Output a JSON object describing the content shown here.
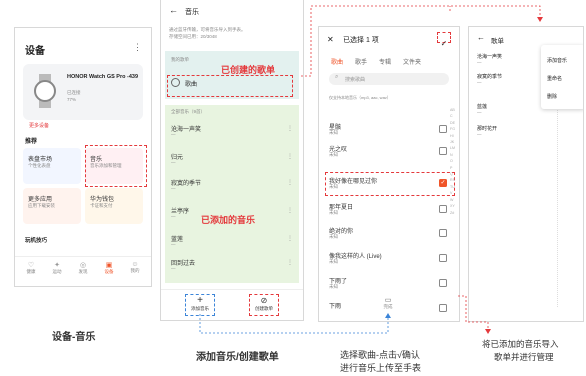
{
  "screen1": {
    "title": "设备",
    "more": "⋮",
    "device_name": "HONOR Watch GS Pro -439",
    "device_status1": "已连接",
    "device_status2": "77%",
    "update_link": "更多设备",
    "recommend": "推荐",
    "cards": [
      {
        "title": "表盘市场",
        "sub": "个性化表盘"
      },
      {
        "title": "音乐",
        "sub": "音乐添加和管理"
      },
      {
        "title": "更多应用",
        "sub": "应用下载安装"
      },
      {
        "title": "华为钱包",
        "sub": "卡证和支付"
      }
    ],
    "section2": "玩机技巧",
    "tabs": [
      "健康",
      "运动",
      "发现",
      "设备",
      "我的"
    ]
  },
  "screen2": {
    "back_icon": "←",
    "title": "音乐",
    "desc1": "通过蓝牙传输，可将音乐导入到手表。",
    "desc2": "存储空间已用：20/3048",
    "section_mine": "我的歌单",
    "playlist_name": "歌曲",
    "annotation_created": "已创建的歌单",
    "section_all": "全部音乐（9首）",
    "songs": [
      "沧海一声笑",
      "归元",
      "寂寞的季节",
      "兰亭序",
      "蓝莲",
      "回到过去",
      "稻香"
    ],
    "annotation_added": "已添加的音乐",
    "add_btn_label": "添加音乐",
    "create_btn_label": "创建歌单"
  },
  "screen3": {
    "close_icon": "✕",
    "title": "已选择 1 项",
    "tabs": [
      "歌曲",
      "歌手",
      "专辑",
      "文件夹"
    ],
    "search_placeholder": "搜索歌曲",
    "hint": "仅支持本地音乐（mp3, aac, wav）",
    "items": [
      {
        "title": "星骸",
        "sub": "未知",
        "checked": false
      },
      {
        "title": "光之叹",
        "sub": "未知",
        "checked": false
      },
      {
        "title": "我好像在哪见过你",
        "sub": "未知",
        "checked": true
      },
      {
        "title": "那年夏日",
        "sub": "未知",
        "checked": false
      },
      {
        "title": "绝对的你",
        "sub": "未知",
        "checked": false
      },
      {
        "title": "像我这样的人 (Live)",
        "sub": "未知",
        "checked": false
      },
      {
        "title": "下雨了",
        "sub": "未知",
        "checked": false
      },
      {
        "title": "下雨",
        "sub": "未知",
        "checked": false
      }
    ],
    "bottom_label": "完成",
    "alphabet": "ABCDEFGHIJKLMNOPQRSTUVWXYZ#"
  },
  "screen4": {
    "back_icon": "←",
    "title": "歌单",
    "songs": [
      "沧海一声笑",
      "寂寞的季节",
      "蓝莲",
      "那时花开"
    ],
    "menu": [
      "添加音乐",
      "重命名",
      "删除"
    ]
  },
  "captions": {
    "c1": "设备-音乐",
    "c2": "添加音乐/创建歌单",
    "c3_line1": "选择歌曲-点击√确认",
    "c3_line2": "进行音乐上传至手表",
    "c4_line1": "将已添加的音乐导入",
    "c4_line2": "歌单并进行管理"
  },
  "colors": {
    "accent": "#e4393c",
    "blue": "#3b84d8",
    "green": "#e8f4e0",
    "orange": "#f0552a"
  }
}
